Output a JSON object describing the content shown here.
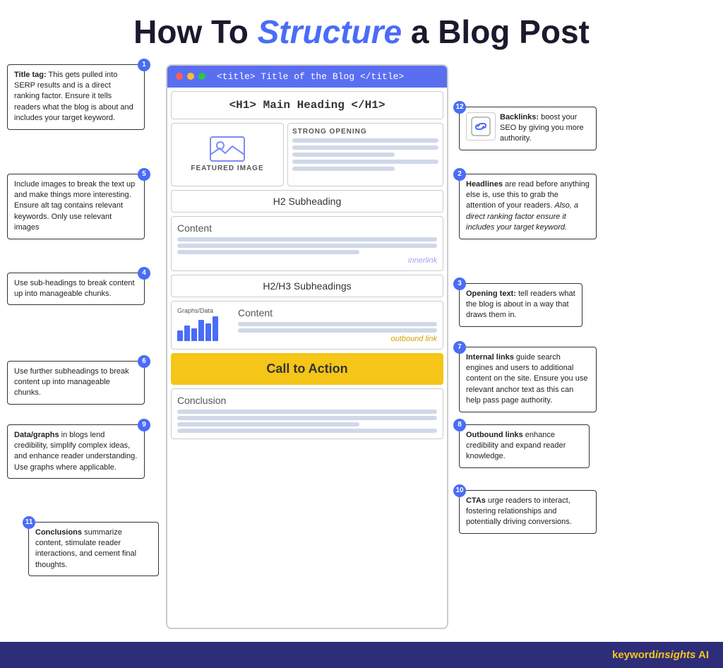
{
  "title": {
    "prefix": "How To ",
    "highlight": "Structure",
    "suffix": " a Blog Post"
  },
  "browser": {
    "title": "<title> Title of the Blog </title>"
  },
  "blog": {
    "h1": "<H1> Main Heading </H1>",
    "featured_image_label": "FEATURED IMAGE",
    "strong_opening_label": "STRONG OPENING",
    "h2_subheading": "H2 Subheading",
    "content": "Content",
    "innerlink": "innerlink",
    "h23_subheading": "H2/H3 Subheadings",
    "graphs_data_label": "Graphs/Data",
    "outbound_link": "outbound link",
    "cta": "Call to Action",
    "conclusion": "Conclusion"
  },
  "annotations": {
    "a1": {
      "num": "1",
      "bold": "Title tag:",
      "text": " This gets pulled into SERP results and is a direct ranking factor. Ensure it tells  readers what the blog is about and includes your target keyword."
    },
    "a5": {
      "num": "5",
      "text": "Include images to break the text up and make things more interesting. Ensure alt tag contains relevant keywords.  Only use relevant images"
    },
    "a4": {
      "num": "4",
      "text": "Use sub-headings to break content up into manageable chunks."
    },
    "a6": {
      "num": "6",
      "text": "Use further subheadings to break content up into manageable chunks."
    },
    "a9": {
      "num": "9",
      "bold": "Data/graphs",
      "text": " in blogs lend credibility, simplify complex ideas, and enhance reader understanding. Use graphs where applicable."
    },
    "a11": {
      "num": "11",
      "bold": "Conclusions",
      "text": " summarize content, stimulate reader interactions, and cement final thoughts."
    },
    "a2": {
      "num": "2",
      "bold": "Headlines",
      "text": " are read before anything else is, use this to grab the attention of your readers. ",
      "italic": "Also, a direct ranking factor ensure it includes your target keyword."
    },
    "a3": {
      "num": "3",
      "bold": "Opening text:",
      "text": " tell readers what the blog is about in a way that draws them in."
    },
    "a7": {
      "num": "7",
      "bold": "Internal links",
      "text": " guide search engines and users to additional content on the site. Ensure you use relevant anchor text as this can help pass page authority."
    },
    "a8": {
      "num": "8",
      "bold": "Outbound links",
      "text": " enhance credibility and expand reader knowledge."
    },
    "a10": {
      "num": "10",
      "bold": "CTAs",
      "text": " urge readers to interact, fostering  relationships and potentially driving conversions."
    },
    "a12": {
      "num": "12",
      "bold": "Backlinks:",
      "text": " boost your SEO by giving you more authority."
    }
  },
  "footer": {
    "brand": "keyword",
    "brand_highlight": "insights",
    "brand_suffix": " AI"
  }
}
